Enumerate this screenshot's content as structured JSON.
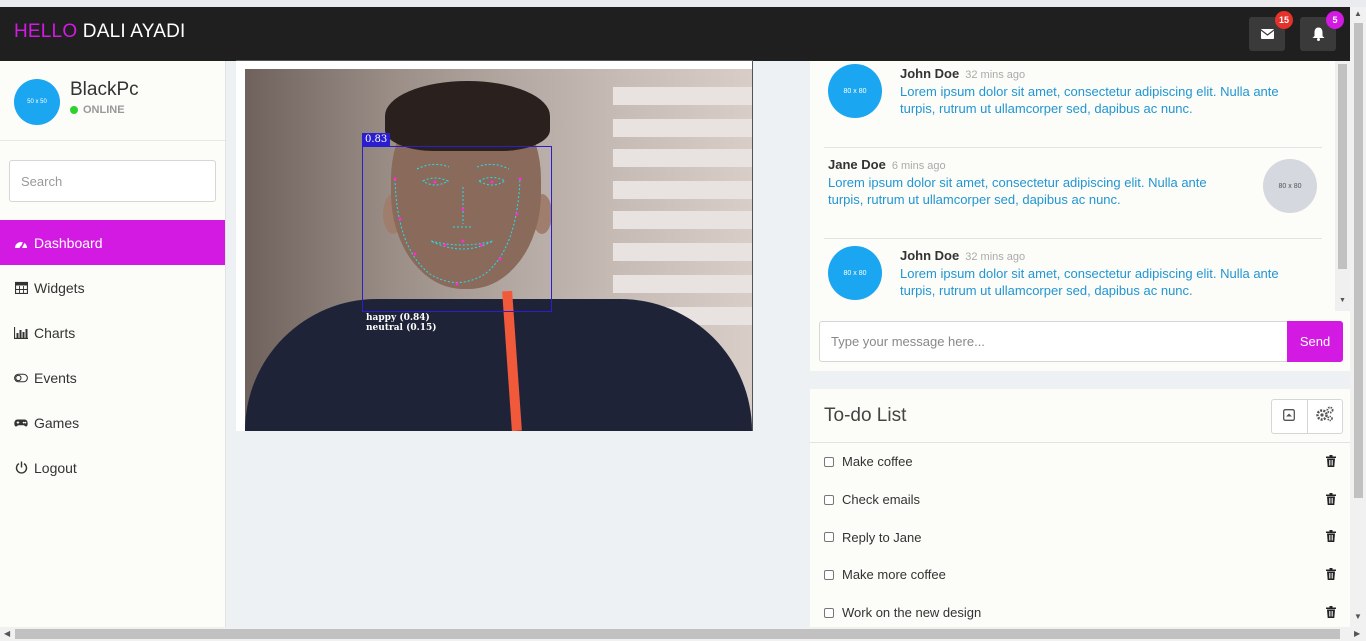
{
  "topbar": {
    "greeting": "HELLO",
    "user_name": "DALI AYADI",
    "messages_badge": "15",
    "notifications_badge": "5",
    "accent_color": "#d21ae3"
  },
  "sidebar": {
    "avatar_text": "50 x 50",
    "profile_name": "BlackPc",
    "profile_status": "ONLINE",
    "search_placeholder": "Search",
    "items": [
      {
        "label": "Dashboard",
        "icon": "dashboard-icon",
        "active": true
      },
      {
        "label": "Widgets",
        "icon": "calendar-icon",
        "active": false
      },
      {
        "label": "Charts",
        "icon": "bar-chart-icon",
        "active": false
      },
      {
        "label": "Events",
        "icon": "toggle-icon",
        "active": false
      },
      {
        "label": "Games",
        "icon": "gamepad-icon",
        "active": false
      },
      {
        "label": "Logout",
        "icon": "power-icon",
        "active": false
      }
    ]
  },
  "video": {
    "confidence_label": "0.83",
    "emotions": [
      "happy (0.84)",
      "neutral (0.15)"
    ]
  },
  "chat": {
    "messages": [
      {
        "name": "John Doe",
        "time": "32 mins ago",
        "avatar_text": "80 x 80",
        "text": "Lorem ipsum dolor sit amet, consectetur adipiscing elit. Nulla ante turpis, rutrum ut ullamcorper sed, dapibus ac nunc."
      },
      {
        "name": "Jane Doe",
        "time": "6 mins ago",
        "avatar_text": "80 x 80",
        "text": "Lorem ipsum dolor sit amet, consectetur adipiscing elit. Nulla ante turpis, rutrum ut ullamcorper sed, dapibus ac nunc."
      },
      {
        "name": "John Doe",
        "time": "32 mins ago",
        "avatar_text": "80 x 80",
        "text": "Lorem ipsum dolor sit amet, consectetur adipiscing elit. Nulla ante turpis, rutrum ut ullamcorper sed, dapibus ac nunc."
      }
    ],
    "input_placeholder": "Type your message here...",
    "send_label": "Send"
  },
  "todo": {
    "title": "To-do List",
    "items": [
      {
        "label": "Make coffee",
        "checked": false
      },
      {
        "label": "Check emails",
        "checked": false
      },
      {
        "label": "Reply to Jane",
        "checked": false
      },
      {
        "label": "Make more coffee",
        "checked": false
      },
      {
        "label": "Work on the new design",
        "checked": false
      }
    ]
  }
}
